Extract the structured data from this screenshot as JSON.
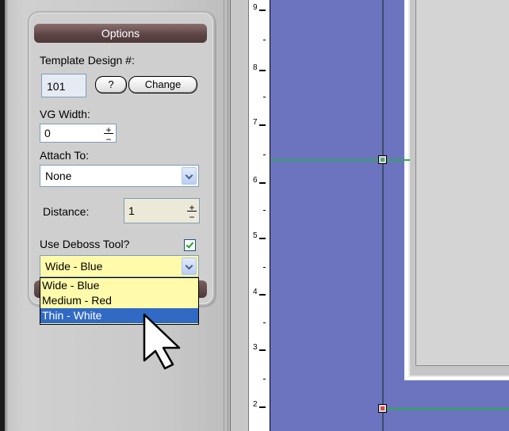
{
  "panel": {
    "title": "Options",
    "template_design_label": "Template Design #:",
    "template_design_value": "101",
    "help_button": "?",
    "change_button": "Change",
    "vg_width_label": "VG Width:",
    "vg_width_value": "0",
    "attach_to_label": "Attach To:",
    "attach_to_value": "None",
    "distance_label": "Distance:",
    "distance_value": "1",
    "deboss_label": "Use Deboss Tool?",
    "deboss_checked": true,
    "deboss_style_value": "Wide - Blue",
    "deboss_options": [
      "Wide - Blue",
      "Medium - Red",
      "Thin - White"
    ],
    "deboss_highlighted": "Thin - White"
  },
  "ruler": {
    "labels": [
      "9",
      "8",
      "7",
      "6",
      "5",
      "4",
      "3",
      "2"
    ]
  },
  "colors": {
    "canvas": "#6c74bf",
    "guide_line": "#29ad52",
    "header": "#5f4646",
    "dropdown_bg": "#fffbaa",
    "selection": "#316ac5"
  },
  "icons": {
    "cursor": "arrow-cursor-icon",
    "dropdown": "chevron-down-icon",
    "spinner": "plus-minus-icon",
    "check": "checkmark-icon"
  }
}
